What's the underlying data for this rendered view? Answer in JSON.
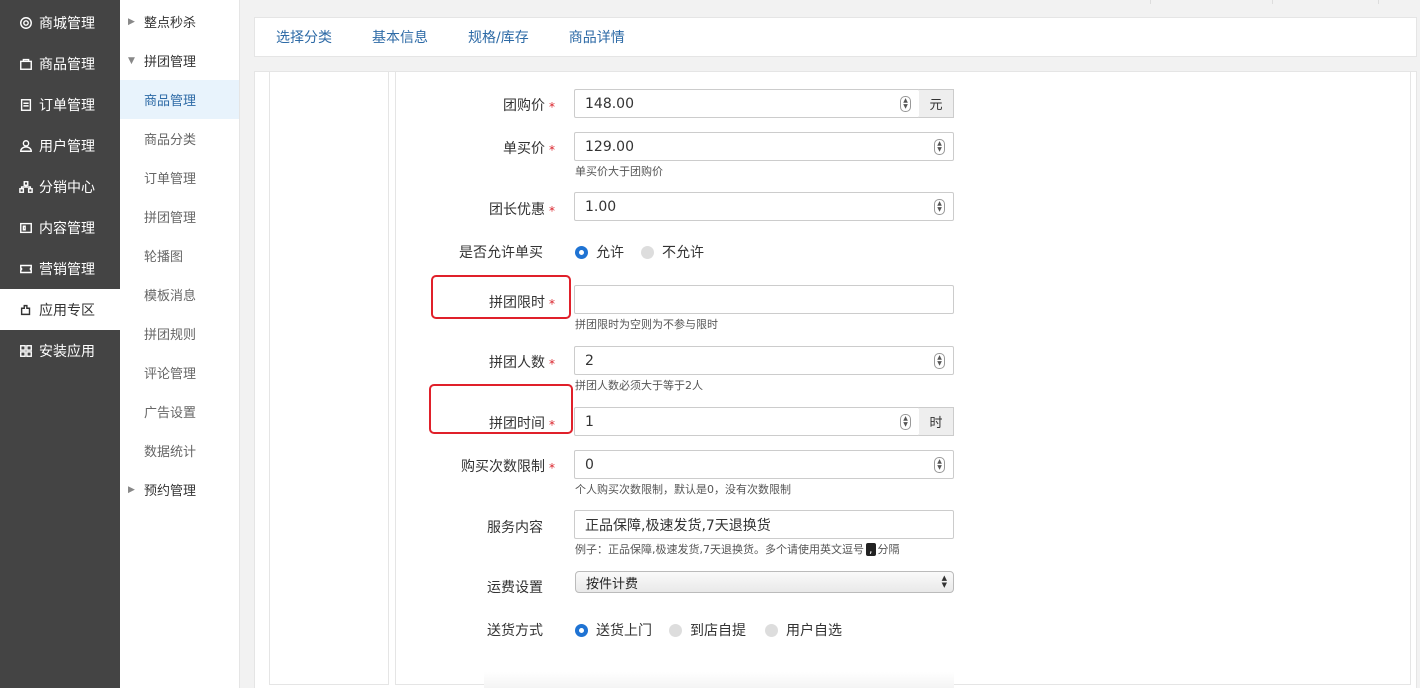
{
  "sidebar_main": {
    "items": [
      {
        "label": "商城管理",
        "icon": "gear-icon"
      },
      {
        "label": "商品管理",
        "icon": "bag-icon"
      },
      {
        "label": "订单管理",
        "icon": "document-icon"
      },
      {
        "label": "用户管理",
        "icon": "user-icon"
      },
      {
        "label": "分销中心",
        "icon": "network-icon"
      },
      {
        "label": "内容管理",
        "icon": "content-icon"
      },
      {
        "label": "营销管理",
        "icon": "ticket-icon"
      },
      {
        "label": "应用专区",
        "icon": "plugin-icon"
      },
      {
        "label": "安装应用",
        "icon": "grid-icon"
      }
    ],
    "active_index": 7
  },
  "sidebar_sub": {
    "group_flash": "整点秒杀",
    "group_pintuan": "拼团管理",
    "sub_items": [
      "商品管理",
      "商品分类",
      "订单管理",
      "拼团管理",
      "轮播图",
      "模板消息",
      "拼团规则",
      "评论管理",
      "广告设置",
      "数据统计"
    ],
    "group_booking": "预约管理"
  },
  "tabs": [
    "选择分类",
    "基本信息",
    "规格/库存",
    "商品详情"
  ],
  "form": {
    "group_price": {
      "label": "团购价",
      "value": "148.00",
      "unit": "元"
    },
    "single_price": {
      "label": "单买价",
      "value": "129.00",
      "help": "单买价大于团购价"
    },
    "leader_discount": {
      "label": "团长优惠",
      "value": "1.00"
    },
    "allow_single": {
      "label": "是否允许单买",
      "opt_yes": "允许",
      "opt_no": "不允许"
    },
    "time_limit": {
      "label": "拼团限时",
      "value": "",
      "help": "拼团限时为空则为不参与限时"
    },
    "group_size": {
      "label": "拼团人数",
      "value": "2",
      "help": "拼团人数必须大于等于2人"
    },
    "group_time": {
      "label": "拼团时间",
      "value": "1",
      "unit": "时"
    },
    "buy_limit": {
      "label": "购买次数限制",
      "value": "0",
      "help": "个人购买次数限制，默认是0，没有次数限制"
    },
    "service": {
      "label": "服务内容",
      "value": "正品保障,极速发货,7天退换货",
      "help_pre": "例子：正品保障,极速发货,7天退换货。多个请使用英文逗号",
      "help_comma": ",",
      "help_post": "分隔"
    },
    "shipping_fee": {
      "label": "运费设置",
      "value": "按件计费"
    },
    "delivery": {
      "label": "送货方式",
      "opt1": "送货上门",
      "opt2": "到店自提",
      "opt3": "用户自选"
    }
  }
}
